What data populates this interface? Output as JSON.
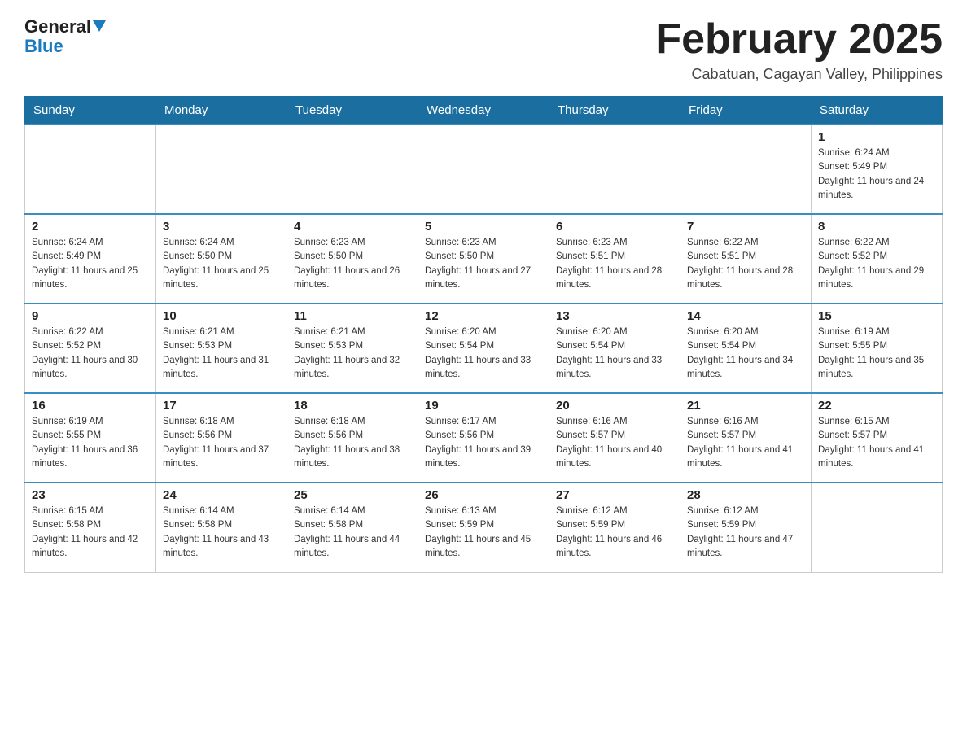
{
  "logo": {
    "general": "General",
    "blue": "Blue"
  },
  "header": {
    "title": "February 2025",
    "subtitle": "Cabatuan, Cagayan Valley, Philippines"
  },
  "days_of_week": [
    "Sunday",
    "Monday",
    "Tuesday",
    "Wednesday",
    "Thursday",
    "Friday",
    "Saturday"
  ],
  "weeks": [
    {
      "days": [
        {
          "empty": true
        },
        {
          "empty": true
        },
        {
          "empty": true
        },
        {
          "empty": true
        },
        {
          "empty": true
        },
        {
          "empty": true
        },
        {
          "date": 1,
          "sunrise": "6:24 AM",
          "sunset": "5:49 PM",
          "daylight": "11 hours and 24 minutes."
        }
      ]
    },
    {
      "days": [
        {
          "date": 2,
          "sunrise": "6:24 AM",
          "sunset": "5:49 PM",
          "daylight": "11 hours and 25 minutes."
        },
        {
          "date": 3,
          "sunrise": "6:24 AM",
          "sunset": "5:50 PM",
          "daylight": "11 hours and 25 minutes."
        },
        {
          "date": 4,
          "sunrise": "6:23 AM",
          "sunset": "5:50 PM",
          "daylight": "11 hours and 26 minutes."
        },
        {
          "date": 5,
          "sunrise": "6:23 AM",
          "sunset": "5:50 PM",
          "daylight": "11 hours and 27 minutes."
        },
        {
          "date": 6,
          "sunrise": "6:23 AM",
          "sunset": "5:51 PM",
          "daylight": "11 hours and 28 minutes."
        },
        {
          "date": 7,
          "sunrise": "6:22 AM",
          "sunset": "5:51 PM",
          "daylight": "11 hours and 28 minutes."
        },
        {
          "date": 8,
          "sunrise": "6:22 AM",
          "sunset": "5:52 PM",
          "daylight": "11 hours and 29 minutes."
        }
      ]
    },
    {
      "days": [
        {
          "date": 9,
          "sunrise": "6:22 AM",
          "sunset": "5:52 PM",
          "daylight": "11 hours and 30 minutes."
        },
        {
          "date": 10,
          "sunrise": "6:21 AM",
          "sunset": "5:53 PM",
          "daylight": "11 hours and 31 minutes."
        },
        {
          "date": 11,
          "sunrise": "6:21 AM",
          "sunset": "5:53 PM",
          "daylight": "11 hours and 32 minutes."
        },
        {
          "date": 12,
          "sunrise": "6:20 AM",
          "sunset": "5:54 PM",
          "daylight": "11 hours and 33 minutes."
        },
        {
          "date": 13,
          "sunrise": "6:20 AM",
          "sunset": "5:54 PM",
          "daylight": "11 hours and 33 minutes."
        },
        {
          "date": 14,
          "sunrise": "6:20 AM",
          "sunset": "5:54 PM",
          "daylight": "11 hours and 34 minutes."
        },
        {
          "date": 15,
          "sunrise": "6:19 AM",
          "sunset": "5:55 PM",
          "daylight": "11 hours and 35 minutes."
        }
      ]
    },
    {
      "days": [
        {
          "date": 16,
          "sunrise": "6:19 AM",
          "sunset": "5:55 PM",
          "daylight": "11 hours and 36 minutes."
        },
        {
          "date": 17,
          "sunrise": "6:18 AM",
          "sunset": "5:56 PM",
          "daylight": "11 hours and 37 minutes."
        },
        {
          "date": 18,
          "sunrise": "6:18 AM",
          "sunset": "5:56 PM",
          "daylight": "11 hours and 38 minutes."
        },
        {
          "date": 19,
          "sunrise": "6:17 AM",
          "sunset": "5:56 PM",
          "daylight": "11 hours and 39 minutes."
        },
        {
          "date": 20,
          "sunrise": "6:16 AM",
          "sunset": "5:57 PM",
          "daylight": "11 hours and 40 minutes."
        },
        {
          "date": 21,
          "sunrise": "6:16 AM",
          "sunset": "5:57 PM",
          "daylight": "11 hours and 41 minutes."
        },
        {
          "date": 22,
          "sunrise": "6:15 AM",
          "sunset": "5:57 PM",
          "daylight": "11 hours and 41 minutes."
        }
      ]
    },
    {
      "days": [
        {
          "date": 23,
          "sunrise": "6:15 AM",
          "sunset": "5:58 PM",
          "daylight": "11 hours and 42 minutes."
        },
        {
          "date": 24,
          "sunrise": "6:14 AM",
          "sunset": "5:58 PM",
          "daylight": "11 hours and 43 minutes."
        },
        {
          "date": 25,
          "sunrise": "6:14 AM",
          "sunset": "5:58 PM",
          "daylight": "11 hours and 44 minutes."
        },
        {
          "date": 26,
          "sunrise": "6:13 AM",
          "sunset": "5:59 PM",
          "daylight": "11 hours and 45 minutes."
        },
        {
          "date": 27,
          "sunrise": "6:12 AM",
          "sunset": "5:59 PM",
          "daylight": "11 hours and 46 minutes."
        },
        {
          "date": 28,
          "sunrise": "6:12 AM",
          "sunset": "5:59 PM",
          "daylight": "11 hours and 47 minutes."
        },
        {
          "empty": true
        }
      ]
    }
  ]
}
